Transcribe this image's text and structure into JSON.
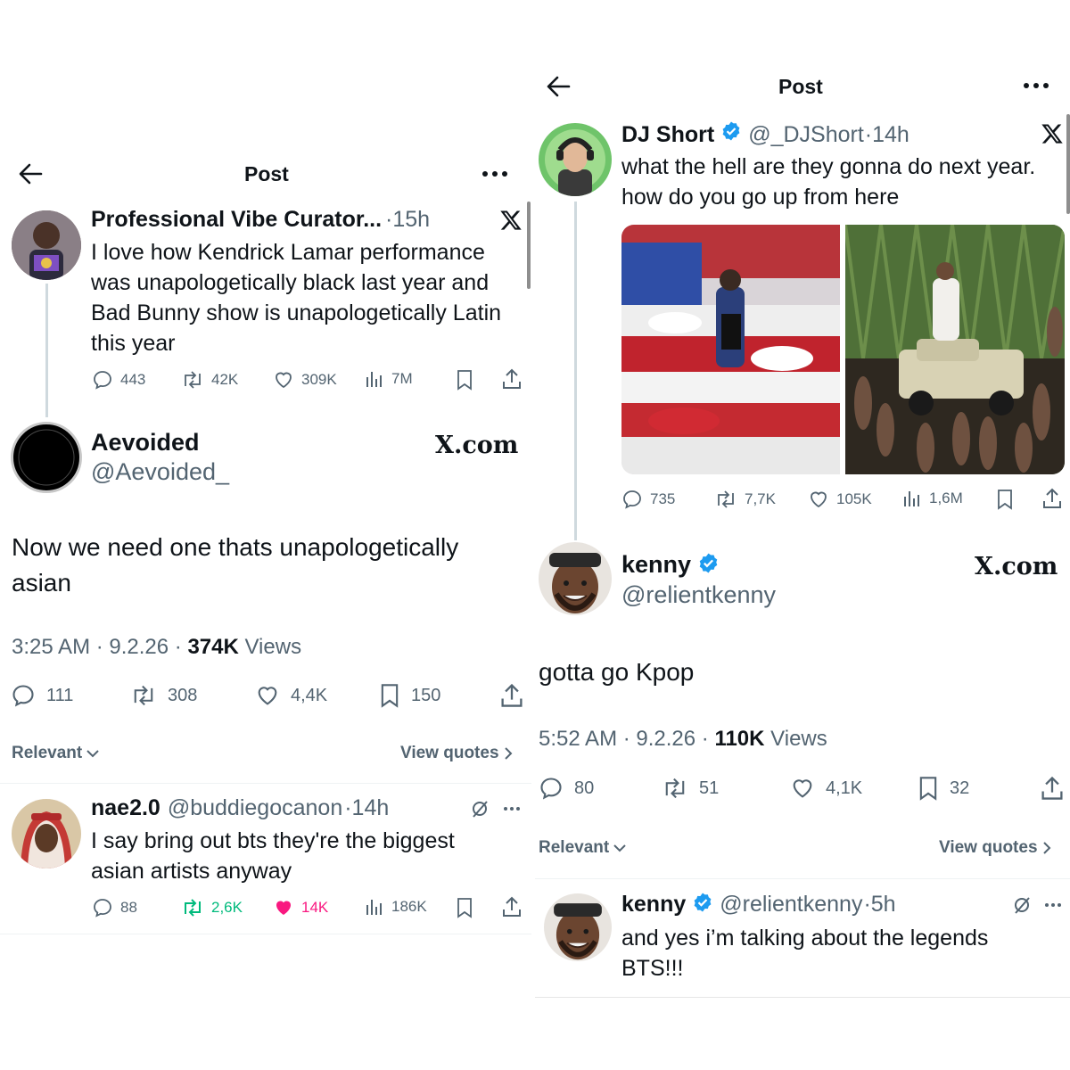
{
  "left": {
    "header": {
      "title": "Post"
    },
    "quoted": {
      "name": "Professional Vibe Curator...",
      "time": "·15h",
      "text": "I love how Kendrick Lamar performance was unapologetically black last year and Bad Bunny show is unapologetically Latin this year",
      "replies": "443",
      "reposts": "42K",
      "likes": "309K",
      "views": "7M"
    },
    "main": {
      "name": "Aevoided",
      "handle": "@Aevoided_",
      "badge": "X.com",
      "text": "Now we need one thats unapologetically asian",
      "time": "3:25 AM · 9.2.26 · ",
      "views_count": "374K",
      "views_label": " Views",
      "replies": "111",
      "reposts": "308",
      "likes": "4,4K",
      "bookmarks": "150"
    },
    "sort": {
      "relevant": "Relevant",
      "view_quotes": "View quotes"
    },
    "reply": {
      "name": "nae2.0",
      "handle": "@buddiegocanon",
      "time": "·14h",
      "text": "I say bring out bts they're the biggest asian artists anyway",
      "replies": "88",
      "reposts": "2,6K",
      "likes": "14K",
      "views": "186K"
    }
  },
  "right": {
    "header": {
      "title": "Post"
    },
    "quoted": {
      "name": "DJ Short",
      "handle": "@_DJShort",
      "time": "·14h",
      "text": "what the hell are they gonna do next year. how do you go up from here",
      "replies": "735",
      "reposts": "7,7K",
      "likes": "105K",
      "views": "1,6M"
    },
    "main": {
      "name": "kenny",
      "handle": "@relientkenny",
      "badge": "X.com",
      "text": "gotta go Kpop",
      "time": "5:52 AM · 9.2.26 · ",
      "views_count": "110K",
      "views_label": " Views",
      "replies": "80",
      "reposts": "51",
      "likes": "4,1K",
      "bookmarks": "32"
    },
    "sort": {
      "relevant": "Relevant",
      "view_quotes": "View quotes"
    },
    "reply": {
      "name": "kenny",
      "handle": "@relientkenny",
      "time": "·5h",
      "text": "and yes i’m talking about the legends BTS!!!"
    }
  },
  "colors": {
    "verified": "#1d9bf0",
    "repost_active": "#00ba7c",
    "like_active": "#f91880",
    "muted": "#536471"
  }
}
